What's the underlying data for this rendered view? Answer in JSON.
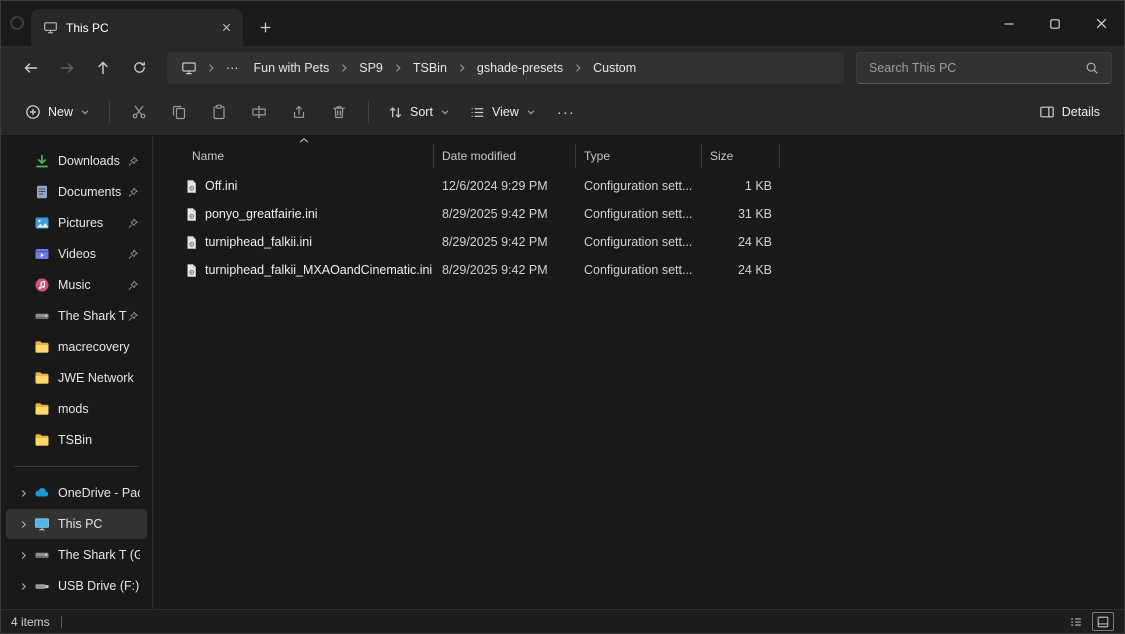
{
  "titlebar": {
    "tab_title": "This PC"
  },
  "navbar": {
    "breadcrumb": {
      "overflow": "···",
      "items": [
        "Fun with Pets",
        "SP9",
        "TSBin",
        "gshade-presets",
        "Custom"
      ]
    },
    "search": {
      "placeholder": "Search This PC"
    }
  },
  "toolbar": {
    "new_label": "New",
    "sort_label": "Sort",
    "view_label": "View",
    "more_label": "···",
    "details_label": "Details"
  },
  "sidebar": {
    "quick_access": [
      {
        "label": "Downloads",
        "pinned": true
      },
      {
        "label": "Documents",
        "pinned": true
      },
      {
        "label": "Pictures",
        "pinned": true
      },
      {
        "label": "Videos",
        "pinned": true
      },
      {
        "label": "Music",
        "pinned": true
      },
      {
        "label": "The Shark T (",
        "pinned": true
      },
      {
        "label": "macrecovery",
        "pinned": false
      },
      {
        "label": "JWE Network",
        "pinned": false
      },
      {
        "label": "mods",
        "pinned": false
      },
      {
        "label": "TSBin",
        "pinned": false
      }
    ],
    "tree": [
      {
        "label": "OneDrive - Pace",
        "selected": false
      },
      {
        "label": "This PC",
        "selected": true
      },
      {
        "label": "The Shark T (G:)",
        "selected": false
      },
      {
        "label": "USB Drive (F:)",
        "selected": false
      }
    ]
  },
  "main": {
    "columns": {
      "name": "Name",
      "date": "Date modified",
      "type": "Type",
      "size": "Size"
    },
    "files": [
      {
        "name": "Off.ini",
        "date": "12/6/2024 9:29 PM",
        "type": "Configuration sett...",
        "size": "1 KB"
      },
      {
        "name": "ponyo_greatfairie.ini",
        "date": "8/29/2025 9:42 PM",
        "type": "Configuration sett...",
        "size": "31 KB"
      },
      {
        "name": "turniphead_falkii.ini",
        "date": "8/29/2025 9:42 PM",
        "type": "Configuration sett...",
        "size": "24 KB"
      },
      {
        "name": "turniphead_falkii_MXAOandCinematic.ini",
        "date": "8/29/2025 9:42 PM",
        "type": "Configuration sett...",
        "size": "24 KB"
      }
    ]
  },
  "statusbar": {
    "count": "4 items"
  },
  "colors": {
    "accent_blue": "#4db5f0",
    "folder_yellow": "#f6c64b",
    "downloads_green": "#4db858",
    "music_pink": "#d25380",
    "onedrive_blue": "#1a9bd7",
    "chrome_bg": "#282828",
    "content_bg": "#191919"
  },
  "icons": {
    "this-pc-icon": "monitor",
    "search-icon": "magnifier",
    "pin-icon": "pushpin",
    "ini-file-icon": "document-with-gear"
  }
}
